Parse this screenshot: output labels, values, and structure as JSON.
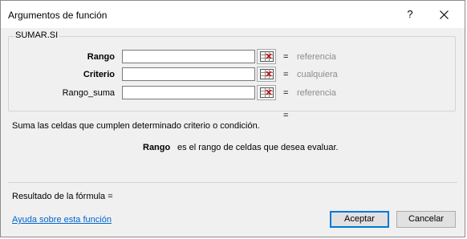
{
  "window": {
    "title": "Argumentos de función",
    "help_label": "?",
    "close_icon": "close-icon"
  },
  "function_group": {
    "name": "SUMAR.SI",
    "args": [
      {
        "label": "Rango",
        "bold": true,
        "value": "",
        "equals": "=",
        "hint": "referencia"
      },
      {
        "label": "Criterio",
        "bold": true,
        "value": "",
        "equals": "=",
        "hint": "cualquiera"
      },
      {
        "label": "Rango_suma",
        "bold": false,
        "value": "",
        "equals": "=",
        "hint": "referencia"
      }
    ],
    "result_equals": "="
  },
  "description": "Suma las celdas que cumplen determinado criterio o condición.",
  "arg_description": {
    "name": "Rango",
    "text": "es el rango de celdas que desea evaluar."
  },
  "formula_result": "Resultado de la fórmula =",
  "help_link": "Ayuda sobre esta función",
  "buttons": {
    "ok": "Aceptar",
    "cancel": "Cancelar"
  },
  "colors": {
    "hint": "#8c8c8c",
    "link": "#0066cc",
    "primary_border": "#0078d7"
  }
}
